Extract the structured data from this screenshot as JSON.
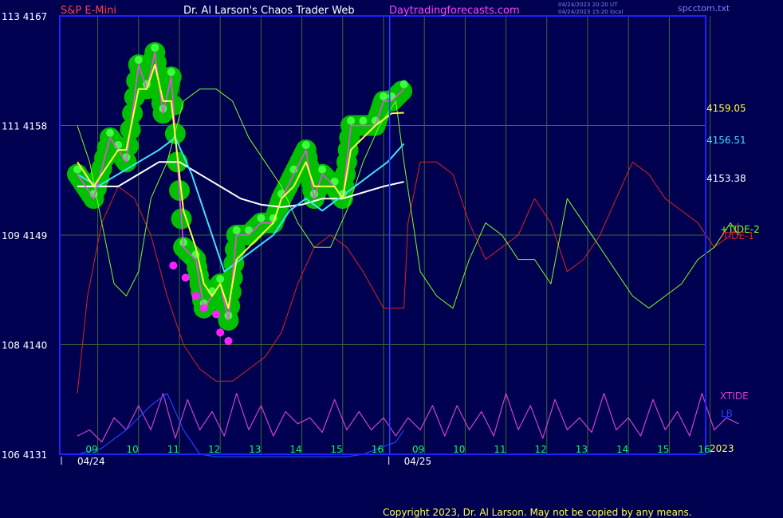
{
  "header": {
    "symbol": "S&P E-Mini",
    "author": "Dr. Al Larson's Chaos Trader Web",
    "site": "Daytradingforecasts.com",
    "stamp_ut": "04/24/2023 20:20 UT",
    "stamp_local": "04/24/2023 15:20 local",
    "file": "spcctom.txt"
  },
  "copyright": "Copyright 2023, Dr. Al Larson. May not be copied by any means.",
  "colors": {
    "background": "#000050",
    "grid": "#3a6a3a",
    "frame": "#2020ff",
    "symbol": "#ff4040",
    "author": "#ffffff",
    "site": "#ff40ff",
    "stamp": "#8080ff",
    "price_axis": "#ffffff",
    "time_axis": "#00ff60",
    "date_axis": "#ffffff",
    "tide1": "#e02020",
    "tide2": "#80ff20",
    "bubble": "#00c000",
    "bubble_highlight": "#40ff40",
    "bubble_magenta": "#ff20ff",
    "price": "#ff40ff",
    "yellow_ma": "#ffff40",
    "cyan_ma": "#40e0ff",
    "white_ma": "#ffffff",
    "xtide": "#d040d0",
    "lb": "#2040ff",
    "divider": "#2040ff"
  },
  "chart_data": {
    "type": "line",
    "title": "S&P E-Mini",
    "x_axis": {
      "time_labels": [
        "09",
        "10",
        "11",
        "12",
        "13",
        "14",
        "15",
        "16",
        "09",
        "10",
        "11",
        "12",
        "13",
        "14",
        "15",
        "16"
      ],
      "date_labels": [
        "04/24",
        "04/25"
      ],
      "year_label": "2023"
    },
    "y_axis": {
      "left_labels": [
        {
          "code": "113",
          "price": "4167"
        },
        {
          "code": "111",
          "price": "4158"
        },
        {
          "code": "109",
          "price": "4149"
        },
        {
          "code": "108",
          "price": "4140"
        },
        {
          "code": "106",
          "price": "4131"
        }
      ],
      "ylim": [
        4131,
        4167
      ]
    },
    "right_labels": {
      "yellow_value": "4159.05",
      "cyan_value": "4156.51",
      "white_value": "4153.38",
      "tide2": "+TIDE-2",
      "tide1": "-TIDE-1",
      "xtide": "XTIDE",
      "lb": "LB"
    },
    "series": [
      {
        "name": "price",
        "x": [
          0.0,
          0.4,
          0.8,
          1.0,
          1.2,
          1.5,
          1.7,
          1.9,
          2.1,
          2.3,
          2.6,
          2.9,
          3.1,
          3.3,
          3.5,
          3.7,
          3.9,
          4.2,
          4.5,
          4.8,
          5.0,
          5.3,
          5.6,
          5.8,
          6.0,
          6.3,
          6.5,
          6.7,
          7.0,
          7.3,
          7.5,
          7.7,
          8.0
        ],
        "values": [
          4154,
          4152,
          4157,
          4156,
          4155,
          4163,
          4161,
          4164,
          4159,
          4162,
          4148,
          4147,
          4143,
          4144,
          4145,
          4142,
          4149,
          4149,
          4150,
          4150,
          4152,
          4154,
          4156,
          4152,
          4154,
          4153,
          4152,
          4158,
          4158,
          4158,
          4160,
          4160,
          4161
        ]
      },
      {
        "name": "yellow_ma",
        "x": [
          0.0,
          0.4,
          0.8,
          1.0,
          1.2,
          1.5,
          1.7,
          1.9,
          2.1,
          2.3,
          2.6,
          2.9,
          3.1,
          3.3,
          3.5,
          3.7,
          3.9,
          4.2,
          4.5,
          4.8,
          5.0,
          5.3,
          5.6,
          5.8,
          6.0,
          6.3,
          6.5,
          6.7,
          7.0,
          7.3,
          7.5,
          7.7,
          8.0
        ],
        "values": [
          4155,
          4153,
          4155,
          4156,
          4156,
          4161,
          4161,
          4163,
          4160,
          4160,
          4151,
          4148,
          4145,
          4144,
          4145,
          4143,
          4147,
          4148,
          4149,
          4150,
          4152,
          4153,
          4155,
          4153,
          4153,
          4153,
          4152,
          4156,
          4157,
          4158,
          4158.5,
          4159,
          4159.05
        ]
      },
      {
        "name": "cyan_ma",
        "x": [
          0.0,
          0.5,
          1.0,
          1.5,
          2.0,
          2.4,
          2.8,
          3.2,
          3.6,
          4.0,
          4.4,
          4.8,
          5.2,
          5.6,
          6.0,
          6.4,
          6.8,
          7.2,
          7.6,
          8.0
        ],
        "values": [
          4154,
          4153,
          4154,
          4155,
          4156,
          4157,
          4154,
          4150,
          4146,
          4147,
          4148,
          4149,
          4151,
          4152,
          4151,
          4152,
          4153,
          4154,
          4155,
          4156.51
        ]
      },
      {
        "name": "white_ma",
        "x": [
          0.0,
          0.5,
          1.0,
          1.5,
          2.0,
          2.5,
          3.0,
          3.5,
          4.0,
          4.5,
          5.0,
          5.5,
          6.0,
          6.5,
          7.0,
          7.5,
          8.0
        ],
        "values": [
          4153,
          4153,
          4153,
          4154,
          4155,
          4155,
          4154,
          4153,
          4152,
          4151.5,
          4151.3,
          4151.5,
          4152,
          4152,
          4152.5,
          4153,
          4153.38
        ]
      },
      {
        "name": "TIDE-1",
        "x": [
          0.0,
          0.25,
          0.6,
          1.0,
          1.4,
          1.8,
          2.2,
          2.6,
          3.0,
          3.4,
          3.8,
          4.2,
          4.6,
          5.0,
          5.4,
          5.8,
          6.2,
          6.6,
          7.0,
          7.5,
          8.0,
          8.1,
          8.4,
          8.8,
          9.2,
          9.6,
          10.0,
          10.4,
          10.8,
          11.2,
          11.6,
          12.0,
          12.4,
          12.8,
          13.2,
          13.6,
          14.0,
          14.4,
          14.8,
          15.2,
          15.6,
          16.0,
          16.2
        ],
        "values": [
          4136,
          4144,
          4150,
          4153,
          4152,
          4149,
          4144,
          4140,
          4138,
          4137,
          4137,
          4138,
          4139,
          4141,
          4145,
          4148,
          4149,
          4148,
          4146,
          4143,
          4143,
          4150,
          4155,
          4155,
          4154,
          4150,
          4147,
          4148,
          4149,
          4152,
          4150,
          4146,
          4147,
          4149,
          4152,
          4155,
          4154,
          4152,
          4151,
          4150,
          4148,
          4149,
          4150
        ]
      },
      {
        "name": "TIDE-2",
        "x": [
          0.0,
          0.3,
          0.6,
          0.9,
          1.2,
          1.5,
          1.8,
          2.2,
          2.6,
          3.0,
          3.4,
          3.8,
          4.2,
          4.6,
          5.0,
          5.4,
          5.8,
          6.2,
          6.6,
          7.0,
          7.4,
          7.8,
          8.0,
          8.4,
          8.8,
          9.2,
          9.6,
          10.0,
          10.4,
          10.8,
          11.2,
          11.6,
          12.0,
          12.4,
          12.8,
          13.2,
          13.6,
          14.0,
          14.4,
          14.8,
          15.2,
          15.6,
          16.0,
          16.2
        ],
        "values": [
          4158,
          4155,
          4150,
          4145,
          4144,
          4146,
          4152,
          4155,
          4160,
          4161,
          4161,
          4160,
          4157,
          4155,
          4153,
          4150,
          4148,
          4148,
          4151,
          4155,
          4158,
          4160,
          4155,
          4146,
          4144,
          4143,
          4147,
          4150,
          4149,
          4147,
          4147,
          4145,
          4152,
          4150,
          4148,
          4146,
          4144,
          4143,
          4144,
          4145,
          4147,
          4148,
          4150,
          4149
        ]
      },
      {
        "name": "XTIDE",
        "x": [
          0.0,
          0.3,
          0.6,
          0.9,
          1.2,
          1.5,
          1.8,
          2.1,
          2.4,
          2.7,
          3.0,
          3.3,
          3.6,
          3.9,
          4.2,
          4.5,
          4.8,
          5.1,
          5.4,
          5.7,
          6.0,
          6.3,
          6.6,
          6.9,
          7.2,
          7.5,
          7.8,
          8.1,
          8.4,
          8.7,
          9.0,
          9.3,
          9.6,
          9.9,
          10.2,
          10.5,
          10.8,
          11.1,
          11.4,
          11.7,
          12.0,
          12.3,
          12.6,
          12.9,
          13.2,
          13.5,
          13.8,
          14.1,
          14.4,
          14.7,
          15.0,
          15.3,
          15.6,
          15.9,
          16.2
        ],
        "values": [
          4132.5,
          4133,
          4132,
          4134,
          4133,
          4135,
          4133,
          4136,
          4132.3,
          4135.5,
          4133,
          4134.5,
          4132.5,
          4136,
          4133,
          4135,
          4132.5,
          4134.5,
          4133.5,
          4134,
          4132.8,
          4135.5,
          4133,
          4134.5,
          4133,
          4134,
          4132.5,
          4134,
          4133,
          4135,
          4132.5,
          4135,
          4133,
          4134.5,
          4132.5,
          4136,
          4133,
          4135,
          4132.3,
          4135.5,
          4133,
          4134,
          4132.8,
          4136,
          4133,
          4134,
          4132.5,
          4135.5,
          4133,
          4134.5,
          4132.5,
          4136,
          4133,
          4134,
          4133.5
        ]
      },
      {
        "name": "LB",
        "x": [
          0.0,
          0.6,
          1.2,
          1.8,
          2.2,
          2.6,
          3.0,
          3.4,
          3.8,
          4.2,
          4.6,
          5.0,
          5.4,
          5.8,
          6.2,
          6.6,
          7.0,
          7.4,
          7.8,
          8.0
        ],
        "values": [
          4131,
          4131.5,
          4133,
          4135,
          4136,
          4133,
          4131,
          4130.8,
          4130.8,
          4130.8,
          4130.8,
          4130.8,
          4130.8,
          4130.8,
          4130.8,
          4130.8,
          4131,
          4131.5,
          4132,
          4133
        ]
      }
    ]
  }
}
